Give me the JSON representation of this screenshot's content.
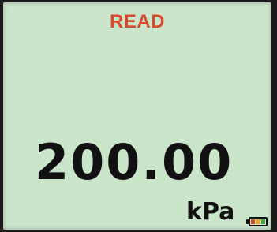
{
  "display": {
    "mode_label": "READ",
    "reading": "200.00",
    "unit": "kPa"
  },
  "battery": {
    "icon": "battery-icon",
    "level": 1.0,
    "segment_colors": [
      "#d64a2e",
      "#e3a83a",
      "#4aa64a"
    ]
  },
  "colors": {
    "lcd_background": "#cbe5cb",
    "mode_text": "#d64a2e",
    "digits": "#111111",
    "bezel": "#1a1a1a"
  }
}
